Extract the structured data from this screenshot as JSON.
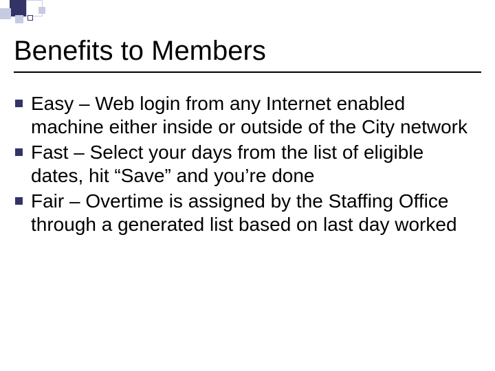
{
  "slide": {
    "title": "Benefits to Members",
    "bullets": [
      "Easy – Web login from any Internet enabled machine either inside or outside of the City network",
      "Fast – Select your days from the list of eligible dates, hit “Save” and you’re done",
      "Fair – Overtime is assigned by the Staffing Office through a generated list based on last day worked"
    ]
  },
  "theme": {
    "accent": "#333366",
    "accent_light": "#c6cbe3",
    "white": "#ffffff"
  }
}
